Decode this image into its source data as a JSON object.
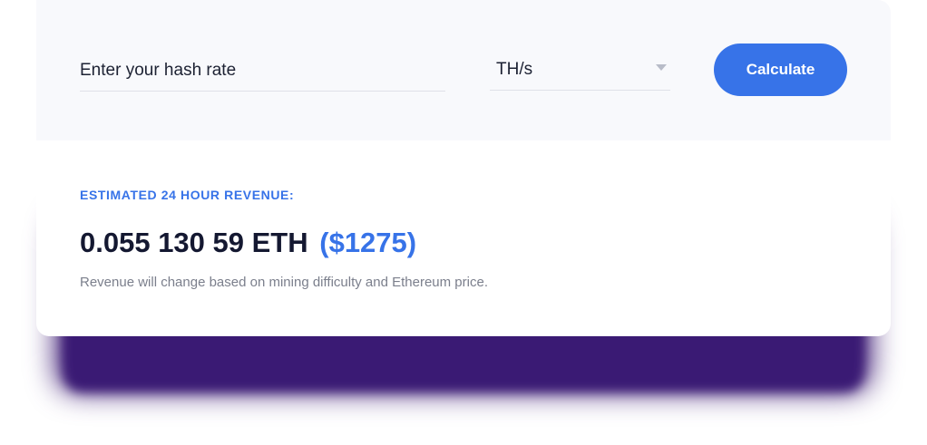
{
  "calculator": {
    "hash_rate_placeholder": "Enter your hash rate",
    "hash_rate_value": "",
    "unit_selected": "TH/s",
    "calculate_label": "Calculate"
  },
  "result": {
    "label": "ESTIMATED 24 HOUR REVENUE:",
    "eth_amount": "0.055 130 59 ETH",
    "usd_amount": "($1275)",
    "note": "Revenue will change based on mining difficulty and Ethereum price."
  },
  "colors": {
    "accent": "#3773e8",
    "shadow": "#3b1873",
    "text_dark": "#141831",
    "text_muted": "#7b7f8c",
    "bar_background": "#f8f9fc"
  },
  "icons": {
    "unit_dropdown": "chevron-down-icon"
  }
}
